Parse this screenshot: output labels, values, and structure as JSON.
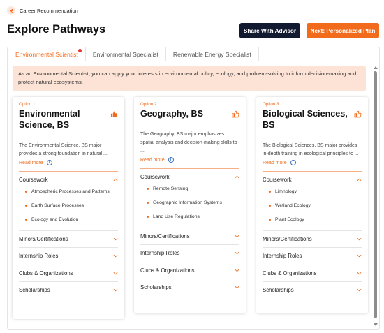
{
  "breadcrumb": "Career Recommendation",
  "page_title": "Explore Pathways",
  "buttons": {
    "share": "Share With Advisor",
    "next": "Next: Personalized Plan"
  },
  "tabs": [
    {
      "label": "Environmental Scientist",
      "active": true
    },
    {
      "label": "Environmental Specialist",
      "active": false
    },
    {
      "label": "Renewable Energy Specialist",
      "active": false
    }
  ],
  "banner": "As an Environmental Scientist, you can apply your interests in environmental policy, ecology, and problem-solving to inform decision-making and protect natural ecosystems.",
  "colors": {
    "accent": "#f26b1d",
    "dark_button": "#111a2e",
    "banner_bg": "#fde3d6"
  },
  "read_more_label": "Read more",
  "cards": [
    {
      "option": "Option 1",
      "title": "Environmental Science, BS",
      "thumb": "thumbs-up-filled",
      "description": "The Environmental Science, BS major provides a strong foundation in natural ...",
      "coursework_label": "Coursework",
      "coursework": [
        "Atmospheric Processes and Patterns",
        "Earth Surface Processes",
        "Ecology and Evolution"
      ],
      "sections": [
        "Minors/Certifications",
        "Internship Roles",
        "Clubs & Organizations",
        "Scholarships"
      ]
    },
    {
      "option": "Option 2",
      "title": "Geography, BS",
      "thumb": "thumbs-up-outline",
      "description": "The Geography, BS major emphasizes spatial analysis and decision-making skills to ...",
      "coursework_label": "Coursework",
      "coursework": [
        "Remote Sensing",
        "Geographic Information Systems",
        "Land Use Regulations"
      ],
      "sections": [
        "Minors/Certifications",
        "Internship Roles",
        "Clubs & Organizations",
        "Scholarships"
      ]
    },
    {
      "option": "Option 3",
      "title": "Biological Sciences, BS",
      "thumb": "thumbs-up-outline",
      "description": "The Biological Sciences, BS major provides in-depth training in ecological principles to ...",
      "coursework_label": "Coursework",
      "coursework": [
        "Limnology",
        "Wetland Ecology",
        "Plant Ecology"
      ],
      "sections": [
        "Minors/Certifications",
        "Internship Roles",
        "Clubs & Organizations",
        "Scholarships"
      ]
    }
  ]
}
